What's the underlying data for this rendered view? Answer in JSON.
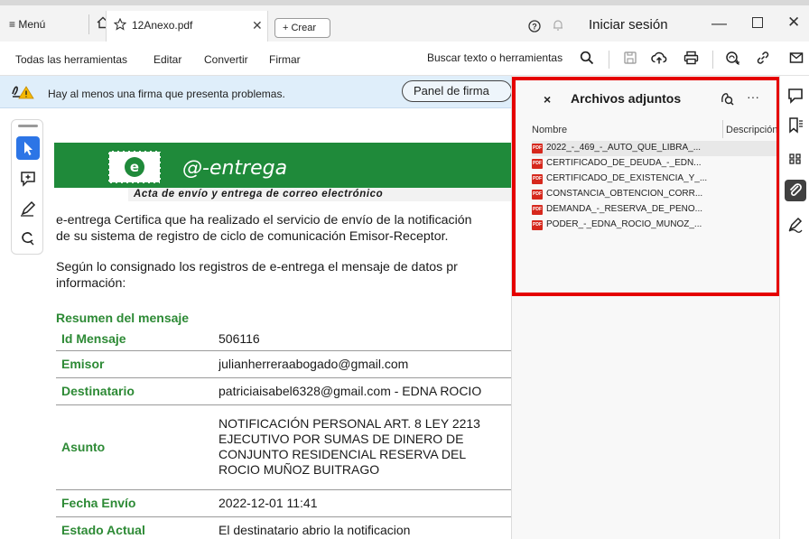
{
  "titlebar": {
    "menu_label": "≡ Menú",
    "tab_label": "12Anexo.pdf",
    "create_label": "+  Crear",
    "signin_label": "Iniciar sesión"
  },
  "toolbar": {
    "all_tools": "Todas las herramientas",
    "edit": "Editar",
    "convert": "Convertir",
    "sign": "Firmar",
    "search": "Buscar texto o herramientas"
  },
  "notification": {
    "text": "Hay al menos una firma que presenta problemas.",
    "button": "Panel de firma"
  },
  "document": {
    "brand": "@-entrega",
    "subtitle": "Acta de envío y entrega de correo electrónico",
    "p1_l1": "e-entrega Certifica que ha realizado el servicio de envío de la notificación",
    "p1_l2": "de su sistema de registro de ciclo de comunicación Emisor-Receptor.",
    "p2_l1": "Según lo consignado los registros de e-entrega el mensaje de datos pr",
    "p2_l2": "información:",
    "summary_heading": "Resumen del mensaje",
    "rows": [
      {
        "key": "Id Mensaje",
        "value": "506116"
      },
      {
        "key": "Emisor",
        "value": "julianherreraabogado@gmail.com"
      },
      {
        "key": "Destinatario",
        "value": "patriciaisabel6328@gmail.com - EDNA ROCIO"
      },
      {
        "key": "Asunto",
        "value_lines": [
          "NOTIFICACIÓN PERSONAL ART. 8 LEY 2213",
          "EJECUTIVO POR SUMAS DE DINERO DE",
          "CONJUNTO RESIDENCIAL RESERVA DEL",
          "ROCIO MUÑOZ BUITRAGO"
        ]
      },
      {
        "key": "Fecha Envío",
        "value": "2022-12-01 11:41"
      },
      {
        "key": "Estado Actual",
        "value": "El destinatario abrio la notificacion"
      }
    ]
  },
  "panel": {
    "close": "×",
    "title": "Archivos adjuntos",
    "more": "···",
    "col_name": "Nombre",
    "col_desc": "Descripción",
    "attachments": [
      "2022_-_469_-_AUTO_QUE_LIBRA_...",
      "CERTIFICADO_DE_DEUDA_-_EDN...",
      "CERTIFICADO_DE_EXISTENCIA_Y_...",
      "CONSTANCIA_OBTENCION_CORR...",
      "DEMANDA_-_RESERVA_DE_PENO...",
      "PODER_-_EDNA_ROCIO_MUNOZ_..."
    ],
    "pdf_badge": "PDF"
  },
  "colors": {
    "highlight": "#e50000",
    "notification_bg": "#dfeefa",
    "doc_green": "#2d8a35",
    "quick_active": "#2c75e6"
  }
}
